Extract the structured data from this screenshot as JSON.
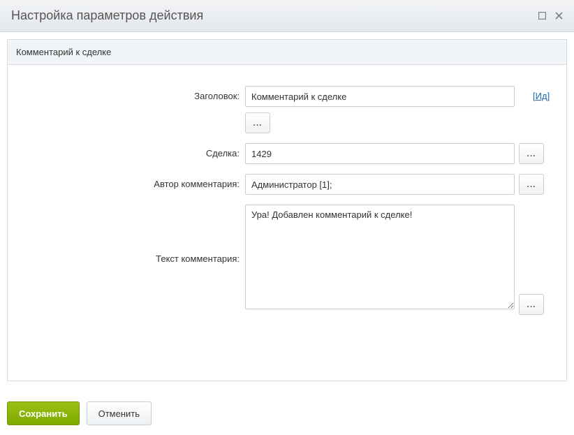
{
  "dialog": {
    "title": "Настройка параметров действия"
  },
  "panel": {
    "title": "Комментарий к сделке"
  },
  "form": {
    "title": {
      "label": "Заголовок:",
      "value": "Комментарий к сделке",
      "id_link": "Ид"
    },
    "deal": {
      "label": "Сделка:",
      "value": "1429"
    },
    "author": {
      "label": "Автор комментария:",
      "value": "Администратор [1];"
    },
    "comment": {
      "label": "Текст комментария:",
      "value": "Ура! Добавлен комментарий к сделке!"
    }
  },
  "buttons": {
    "save": "Сохранить",
    "cancel": "Отменить",
    "more": "..."
  }
}
